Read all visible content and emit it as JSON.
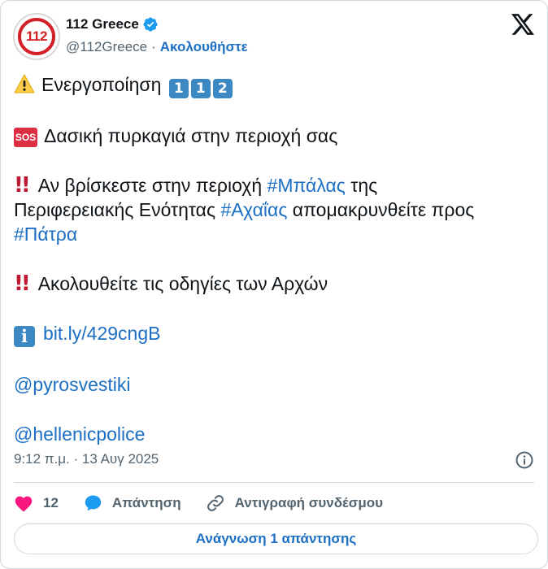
{
  "author": {
    "display_name": "112 Greece",
    "handle": "@112Greece",
    "separator": "·",
    "follow_label": "Ακολουθήστε",
    "avatar_text": "112"
  },
  "tweet": {
    "line1_text": "Ενεργοποίηση",
    "keycaps": [
      "1",
      "1",
      "2"
    ],
    "line2_badge": "SOS",
    "line2_text": "Δασική πυρκαγιά στην περιοχή σας",
    "line3_prefix": "Αν βρίσκεστε στην περιοχή ",
    "line3_hashtag": "#Μπάλας",
    "line3_suffix": " της",
    "line4_prefix": "Περιφερειακής Ενότητας ",
    "line4_hashtag": "#Αχαΐας",
    "line4_suffix": " απομακρυνθείτε προς",
    "line5_hashtag": "#Πάτρα",
    "line6_text": "Ακολουθείτε τις οδηγίες των Αρχών",
    "info_glyph": "i",
    "link": "bit.ly/429cngB",
    "mention1": "@pyrosvestiki",
    "mention2": "@hellenicpolice"
  },
  "meta": {
    "timestamp": "9:12 π.μ. · 13 Αυγ 2025"
  },
  "actions": {
    "like_count": "12",
    "reply_label": "Απάντηση",
    "copy_label": "Αντιγραφή συνδέσμου"
  },
  "replies_button": "Ανάγνωση 1 απάντησης",
  "colors": {
    "link": "#1d6fc4",
    "heart": "#f91880",
    "text": "#0f1419",
    "muted": "#536471",
    "border": "#cfd9de"
  }
}
